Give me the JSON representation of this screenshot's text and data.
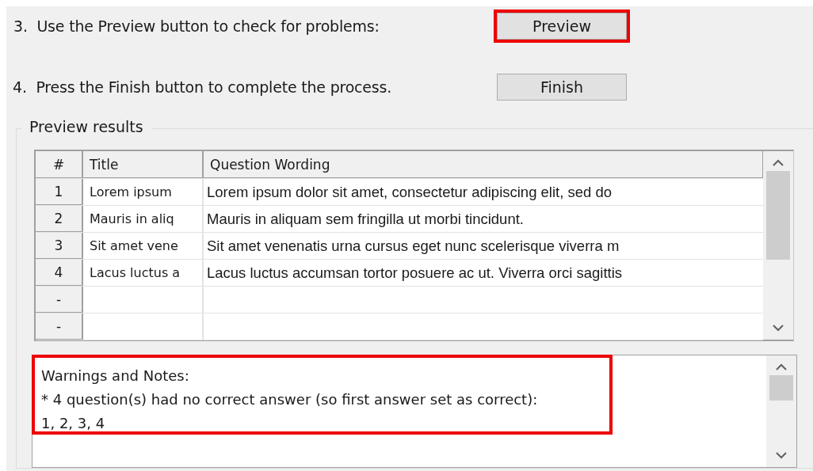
{
  "steps": [
    {
      "number": "3.",
      "text": "Use the Preview button to check for problems:",
      "button": "Preview",
      "highlighted": true
    },
    {
      "number": "4.",
      "text": "Press the Finish button to complete the process.",
      "button": "Finish",
      "highlighted": false
    }
  ],
  "preview_results": {
    "label": "Preview results",
    "table": {
      "columns": [
        "#",
        "Title",
        "Question Wording"
      ],
      "rows": [
        {
          "number": "1",
          "title": "Lorem ipsum",
          "wording": "Lorem ipsum dolor sit amet, consectetur adipiscing elit, sed do"
        },
        {
          "number": "2",
          "title": "Mauris in aliq",
          "wording": "Mauris in aliquam sem fringilla ut morbi tincidunt."
        },
        {
          "number": "3",
          "title": "Sit amet vene",
          "wording": "Sit amet venenatis urna cursus eget nunc scelerisque viverra m"
        },
        {
          "number": "4",
          "title": "Lacus luctus a",
          "wording": "Lacus luctus accumsan tortor posuere ac ut. Viverra orci sagittis"
        },
        {
          "number": "-",
          "title": "",
          "wording": ""
        },
        {
          "number": "-",
          "title": "",
          "wording": ""
        }
      ]
    },
    "notes": {
      "highlighted": true,
      "lines": [
        "Warnings and Notes:",
        "* 4 question(s) had no correct answer (so first answer set as correct):",
        "1, 2, 3, 4"
      ]
    }
  }
}
